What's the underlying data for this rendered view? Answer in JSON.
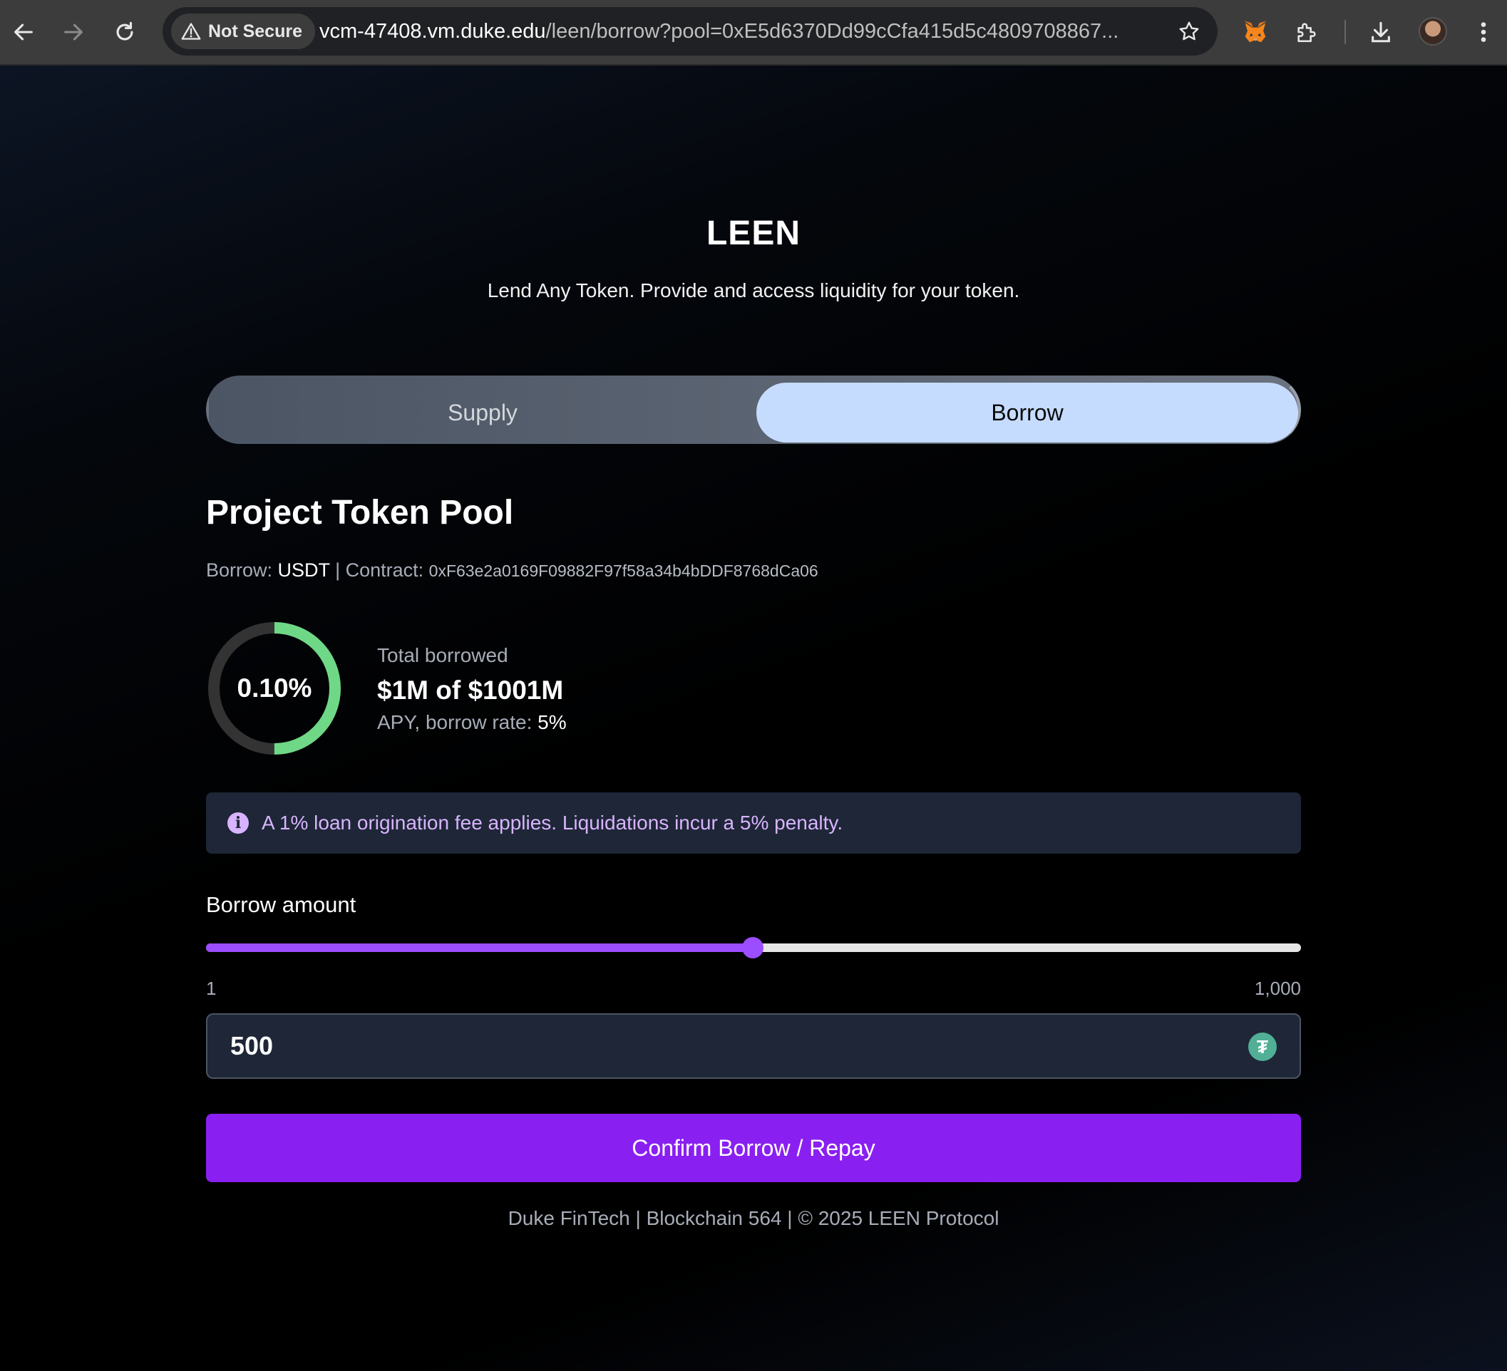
{
  "browser": {
    "security_label": "Not Secure",
    "url_host": "vcm-47408.vm.duke.edu",
    "url_path": "/leen/borrow?pool=0xE5d6370Dd99cCfa415d5c4809708867..."
  },
  "app": {
    "brand": "LEEN",
    "tagline": "Lend Any Token. Provide and access liquidity for your token."
  },
  "tabs": {
    "supply": "Supply",
    "borrow": "Borrow",
    "active": "borrow"
  },
  "pool": {
    "title": "Project Token Pool",
    "borrow_label": "Borrow:",
    "borrow_token": "USDT",
    "separator": "|",
    "contract_label": "Contract:",
    "contract_address": "0xF63e2a0169F09882F97f58a34b4bDDF8768dCa06"
  },
  "stats": {
    "utilization_text": "0.10%",
    "gauge_fraction": 0.5,
    "total_label": "Total borrowed",
    "total_value": "$1M of $1001M",
    "apy_label": "APY, borrow rate:",
    "apy_value": "5%",
    "gauge_colors": {
      "fill": "#6fd887",
      "track": "#333333"
    }
  },
  "notice": {
    "icon": "info-icon",
    "text": "A 1% loan origination fee applies. Liquidations incur a 5% penalty."
  },
  "borrow_amount": {
    "label": "Borrow amount",
    "min_label": "1",
    "max_label": "1,000",
    "min": 1,
    "max": 1000,
    "value": 500,
    "input_value": "500",
    "token_icon": "tether-icon"
  },
  "actions": {
    "confirm": "Confirm Borrow / Repay"
  },
  "footer": {
    "text": "Duke FinTech | Blockchain 564 | © 2025 LEEN Protocol"
  }
}
